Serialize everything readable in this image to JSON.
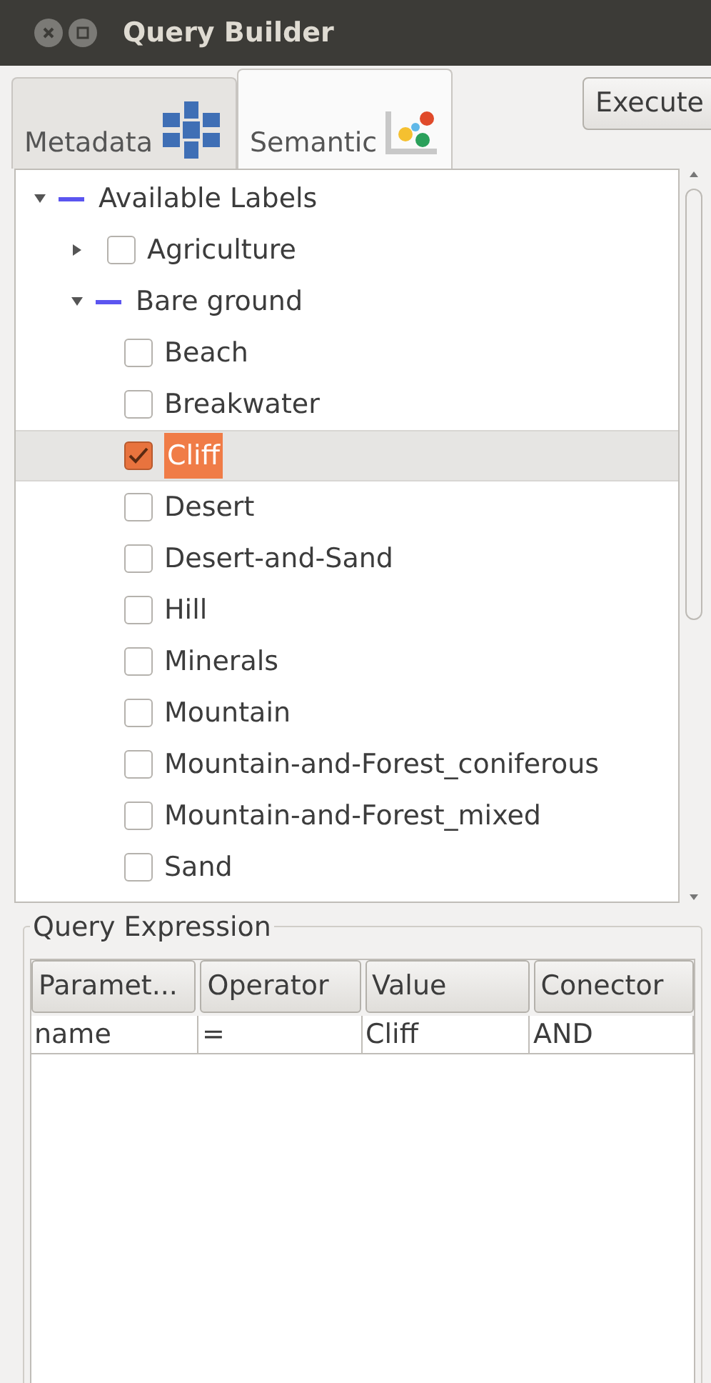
{
  "window": {
    "title": "Query Builder"
  },
  "tabs": [
    {
      "label": "Metadata",
      "selected": false
    },
    {
      "label": "Semantic",
      "selected": true
    }
  ],
  "execute_button": "Execute",
  "tree": [
    {
      "label": "Available Labels",
      "expanded": true,
      "selected": false,
      "children": [
        {
          "label": "Agriculture",
          "expanded": false,
          "checked": false,
          "selected": false
        },
        {
          "label": "Bare ground",
          "expanded": true,
          "selected": false,
          "children": [
            {
              "label": "Beach",
              "checked": false,
              "selected": false
            },
            {
              "label": "Breakwater",
              "checked": false,
              "selected": false
            },
            {
              "label": "Cliff",
              "checked": true,
              "selected": true
            },
            {
              "label": "Desert",
              "checked": false,
              "selected": false
            },
            {
              "label": "Desert-and-Sand",
              "checked": false,
              "selected": false
            },
            {
              "label": "Hill",
              "checked": false,
              "selected": false
            },
            {
              "label": "Minerals",
              "checked": false,
              "selected": false
            },
            {
              "label": "Mountain",
              "checked": false,
              "selected": false
            },
            {
              "label": "Mountain-and-Forest_coniferous",
              "checked": false,
              "selected": false
            },
            {
              "label": "Mountain-and-Forest_mixed",
              "checked": false,
              "selected": false
            },
            {
              "label": "Sand",
              "checked": false,
              "selected": false
            }
          ]
        }
      ]
    }
  ],
  "query_expression": {
    "title": "Query Expression",
    "columns": [
      "Paramet...",
      "Operator",
      "Value",
      "Conector"
    ],
    "rows": [
      [
        "name",
        "=",
        "Cliff",
        "AND"
      ]
    ]
  }
}
